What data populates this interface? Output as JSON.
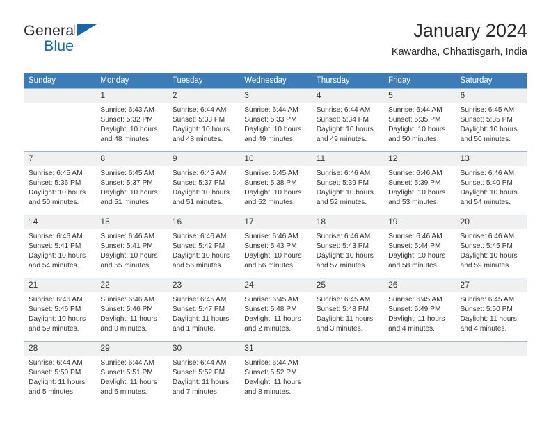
{
  "brand": {
    "name_part1": "General",
    "name_part2": "Blue"
  },
  "header": {
    "title": "January 2024",
    "subtitle": "Kawardha, Chhattisgarh, India"
  },
  "colors": {
    "header_blue": "#3c7cb8",
    "brand_blue": "#1268b3",
    "daynum_bg": "#f0f0f0",
    "grid_line": "#9bb9d4"
  },
  "weekdays": [
    "Sunday",
    "Monday",
    "Tuesday",
    "Wednesday",
    "Thursday",
    "Friday",
    "Saturday"
  ],
  "labels": {
    "sunrise": "Sunrise:",
    "sunset": "Sunset:",
    "daylight": "Daylight:"
  },
  "weeks": [
    [
      {
        "day": "",
        "sunrise": "",
        "sunset": "",
        "daylight_line1": "",
        "daylight_line2": ""
      },
      {
        "day": "1",
        "sunrise": "Sunrise: 6:43 AM",
        "sunset": "Sunset: 5:32 PM",
        "daylight_line1": "Daylight: 10 hours",
        "daylight_line2": "and 48 minutes."
      },
      {
        "day": "2",
        "sunrise": "Sunrise: 6:44 AM",
        "sunset": "Sunset: 5:33 PM",
        "daylight_line1": "Daylight: 10 hours",
        "daylight_line2": "and 48 minutes."
      },
      {
        "day": "3",
        "sunrise": "Sunrise: 6:44 AM",
        "sunset": "Sunset: 5:33 PM",
        "daylight_line1": "Daylight: 10 hours",
        "daylight_line2": "and 49 minutes."
      },
      {
        "day": "4",
        "sunrise": "Sunrise: 6:44 AM",
        "sunset": "Sunset: 5:34 PM",
        "daylight_line1": "Daylight: 10 hours",
        "daylight_line2": "and 49 minutes."
      },
      {
        "day": "5",
        "sunrise": "Sunrise: 6:44 AM",
        "sunset": "Sunset: 5:35 PM",
        "daylight_line1": "Daylight: 10 hours",
        "daylight_line2": "and 50 minutes."
      },
      {
        "day": "6",
        "sunrise": "Sunrise: 6:45 AM",
        "sunset": "Sunset: 5:35 PM",
        "daylight_line1": "Daylight: 10 hours",
        "daylight_line2": "and 50 minutes."
      }
    ],
    [
      {
        "day": "7",
        "sunrise": "Sunrise: 6:45 AM",
        "sunset": "Sunset: 5:36 PM",
        "daylight_line1": "Daylight: 10 hours",
        "daylight_line2": "and 50 minutes."
      },
      {
        "day": "8",
        "sunrise": "Sunrise: 6:45 AM",
        "sunset": "Sunset: 5:37 PM",
        "daylight_line1": "Daylight: 10 hours",
        "daylight_line2": "and 51 minutes."
      },
      {
        "day": "9",
        "sunrise": "Sunrise: 6:45 AM",
        "sunset": "Sunset: 5:37 PM",
        "daylight_line1": "Daylight: 10 hours",
        "daylight_line2": "and 51 minutes."
      },
      {
        "day": "10",
        "sunrise": "Sunrise: 6:45 AM",
        "sunset": "Sunset: 5:38 PM",
        "daylight_line1": "Daylight: 10 hours",
        "daylight_line2": "and 52 minutes."
      },
      {
        "day": "11",
        "sunrise": "Sunrise: 6:46 AM",
        "sunset": "Sunset: 5:39 PM",
        "daylight_line1": "Daylight: 10 hours",
        "daylight_line2": "and 52 minutes."
      },
      {
        "day": "12",
        "sunrise": "Sunrise: 6:46 AM",
        "sunset": "Sunset: 5:39 PM",
        "daylight_line1": "Daylight: 10 hours",
        "daylight_line2": "and 53 minutes."
      },
      {
        "day": "13",
        "sunrise": "Sunrise: 6:46 AM",
        "sunset": "Sunset: 5:40 PM",
        "daylight_line1": "Daylight: 10 hours",
        "daylight_line2": "and 54 minutes."
      }
    ],
    [
      {
        "day": "14",
        "sunrise": "Sunrise: 6:46 AM",
        "sunset": "Sunset: 5:41 PM",
        "daylight_line1": "Daylight: 10 hours",
        "daylight_line2": "and 54 minutes."
      },
      {
        "day": "15",
        "sunrise": "Sunrise: 6:46 AM",
        "sunset": "Sunset: 5:41 PM",
        "daylight_line1": "Daylight: 10 hours",
        "daylight_line2": "and 55 minutes."
      },
      {
        "day": "16",
        "sunrise": "Sunrise: 6:46 AM",
        "sunset": "Sunset: 5:42 PM",
        "daylight_line1": "Daylight: 10 hours",
        "daylight_line2": "and 56 minutes."
      },
      {
        "day": "17",
        "sunrise": "Sunrise: 6:46 AM",
        "sunset": "Sunset: 5:43 PM",
        "daylight_line1": "Daylight: 10 hours",
        "daylight_line2": "and 56 minutes."
      },
      {
        "day": "18",
        "sunrise": "Sunrise: 6:46 AM",
        "sunset": "Sunset: 5:43 PM",
        "daylight_line1": "Daylight: 10 hours",
        "daylight_line2": "and 57 minutes."
      },
      {
        "day": "19",
        "sunrise": "Sunrise: 6:46 AM",
        "sunset": "Sunset: 5:44 PM",
        "daylight_line1": "Daylight: 10 hours",
        "daylight_line2": "and 58 minutes."
      },
      {
        "day": "20",
        "sunrise": "Sunrise: 6:46 AM",
        "sunset": "Sunset: 5:45 PM",
        "daylight_line1": "Daylight: 10 hours",
        "daylight_line2": "and 59 minutes."
      }
    ],
    [
      {
        "day": "21",
        "sunrise": "Sunrise: 6:46 AM",
        "sunset": "Sunset: 5:46 PM",
        "daylight_line1": "Daylight: 10 hours",
        "daylight_line2": "and 59 minutes."
      },
      {
        "day": "22",
        "sunrise": "Sunrise: 6:46 AM",
        "sunset": "Sunset: 5:46 PM",
        "daylight_line1": "Daylight: 11 hours",
        "daylight_line2": "and 0 minutes."
      },
      {
        "day": "23",
        "sunrise": "Sunrise: 6:45 AM",
        "sunset": "Sunset: 5:47 PM",
        "daylight_line1": "Daylight: 11 hours",
        "daylight_line2": "and 1 minute."
      },
      {
        "day": "24",
        "sunrise": "Sunrise: 6:45 AM",
        "sunset": "Sunset: 5:48 PM",
        "daylight_line1": "Daylight: 11 hours",
        "daylight_line2": "and 2 minutes."
      },
      {
        "day": "25",
        "sunrise": "Sunrise: 6:45 AM",
        "sunset": "Sunset: 5:48 PM",
        "daylight_line1": "Daylight: 11 hours",
        "daylight_line2": "and 3 minutes."
      },
      {
        "day": "26",
        "sunrise": "Sunrise: 6:45 AM",
        "sunset": "Sunset: 5:49 PM",
        "daylight_line1": "Daylight: 11 hours",
        "daylight_line2": "and 4 minutes."
      },
      {
        "day": "27",
        "sunrise": "Sunrise: 6:45 AM",
        "sunset": "Sunset: 5:50 PM",
        "daylight_line1": "Daylight: 11 hours",
        "daylight_line2": "and 4 minutes."
      }
    ],
    [
      {
        "day": "28",
        "sunrise": "Sunrise: 6:44 AM",
        "sunset": "Sunset: 5:50 PM",
        "daylight_line1": "Daylight: 11 hours",
        "daylight_line2": "and 5 minutes."
      },
      {
        "day": "29",
        "sunrise": "Sunrise: 6:44 AM",
        "sunset": "Sunset: 5:51 PM",
        "daylight_line1": "Daylight: 11 hours",
        "daylight_line2": "and 6 minutes."
      },
      {
        "day": "30",
        "sunrise": "Sunrise: 6:44 AM",
        "sunset": "Sunset: 5:52 PM",
        "daylight_line1": "Daylight: 11 hours",
        "daylight_line2": "and 7 minutes."
      },
      {
        "day": "31",
        "sunrise": "Sunrise: 6:44 AM",
        "sunset": "Sunset: 5:52 PM",
        "daylight_line1": "Daylight: 11 hours",
        "daylight_line2": "and 8 minutes."
      },
      {
        "day": "",
        "sunrise": "",
        "sunset": "",
        "daylight_line1": "",
        "daylight_line2": ""
      },
      {
        "day": "",
        "sunrise": "",
        "sunset": "",
        "daylight_line1": "",
        "daylight_line2": ""
      },
      {
        "day": "",
        "sunrise": "",
        "sunset": "",
        "daylight_line1": "",
        "daylight_line2": ""
      }
    ]
  ]
}
